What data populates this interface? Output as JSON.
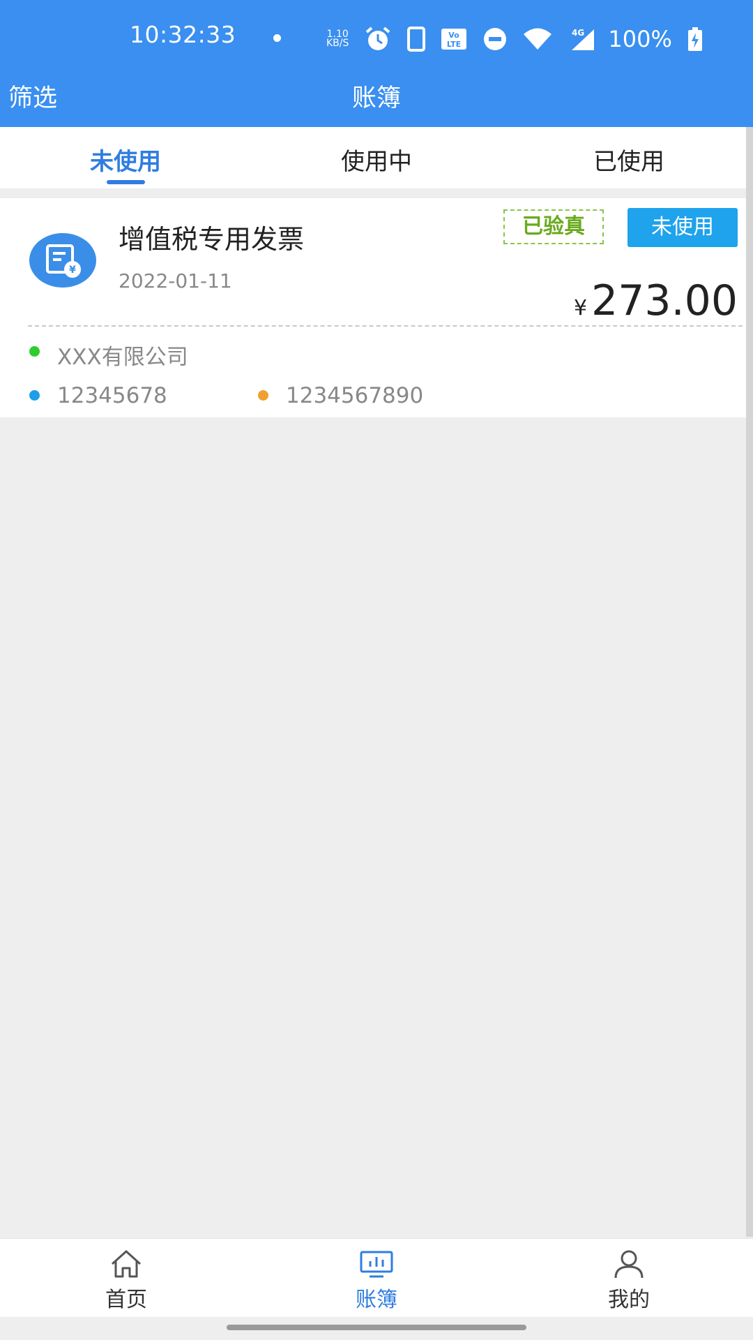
{
  "status_bar": {
    "time": "10:32:33",
    "net_speed_value": "1.10",
    "net_speed_unit": "KB/S",
    "volte": "Vo LTE",
    "network": "4G",
    "battery": "100%",
    "icons": [
      "alarm-icon",
      "phone-icon",
      "volte-icon",
      "dnd-icon",
      "wifi-icon",
      "signal-icon",
      "battery-charging-icon"
    ]
  },
  "header": {
    "filter_label": "筛选",
    "title": "账簿",
    "color": "#3a8ff0"
  },
  "tabs": [
    {
      "label": "未使用",
      "active": true
    },
    {
      "label": "使用中",
      "active": false
    },
    {
      "label": "已使用",
      "active": false
    }
  ],
  "invoice": {
    "icon": "invoice-yen-icon",
    "title": "增值税专用发票",
    "date": "2022-01-11",
    "verified_label": "已验真",
    "status_label": "未使用",
    "currency_symbol": "¥",
    "amount": "273.00",
    "company": "XXX有限公司",
    "code": "12345678",
    "number": "1234567890",
    "dot_colors": {
      "company": "#2ecc2e",
      "code": "#1e9ee8",
      "number": "#f0a030"
    }
  },
  "bottom_nav": [
    {
      "label": "首页",
      "icon": "home-icon",
      "active": false
    },
    {
      "label": "账簿",
      "icon": "ledger-chart-icon",
      "active": true
    },
    {
      "label": "我的",
      "icon": "user-icon",
      "active": false
    }
  ],
  "accent_color": "#2f7de0"
}
